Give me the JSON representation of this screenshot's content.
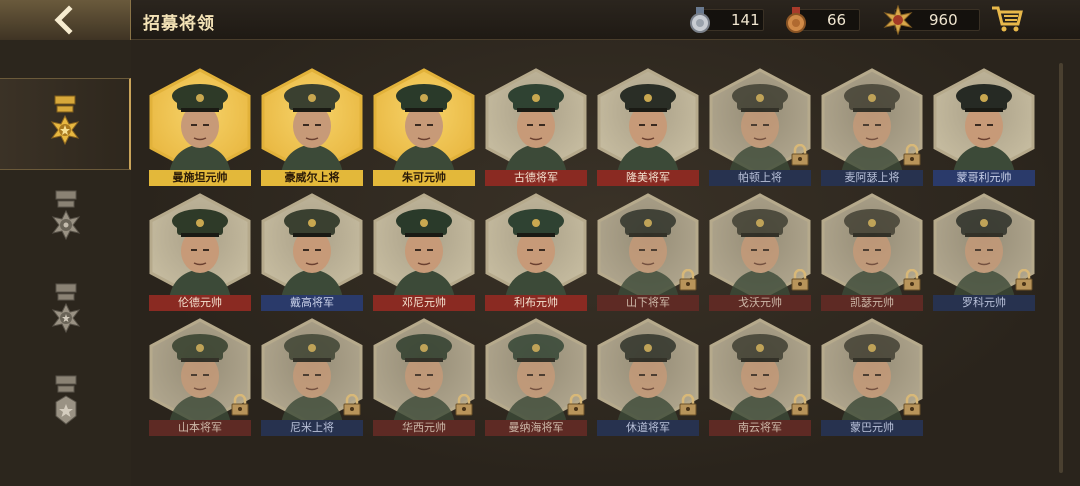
{
  "header": {
    "title": "招募将领",
    "resources": [
      {
        "icon": "silver-medal-icon",
        "value": "141"
      },
      {
        "icon": "bronze-medal-icon",
        "value": "66"
      },
      {
        "icon": "gold-star-badge-icon",
        "value": "960"
      }
    ]
  },
  "sidebar": {
    "tabs": [
      {
        "icon": "marshal-rank-medal-icon",
        "active": true
      },
      {
        "icon": "general-rank-medal-icon",
        "active": false
      },
      {
        "icon": "lieutenant-rank-medal-icon",
        "active": false
      },
      {
        "icon": "major-rank-medal-icon",
        "active": false
      }
    ]
  },
  "generals": [
    [
      {
        "name": "曼施坦元帅",
        "style": "yellow",
        "locked": false
      },
      {
        "name": "豪威尔上将",
        "style": "yellow",
        "locked": false
      },
      {
        "name": "朱可元帅",
        "style": "yellow",
        "locked": false
      },
      {
        "name": "古德将军",
        "style": "red",
        "locked": false
      },
      {
        "name": "隆美将军",
        "style": "red",
        "locked": false
      },
      {
        "name": "帕顿上将",
        "style": "blue",
        "locked": true
      },
      {
        "name": "麦阿瑟上将",
        "style": "blue",
        "locked": true
      },
      {
        "name": "蒙哥利元帅",
        "style": "blue",
        "locked": false
      }
    ],
    [
      {
        "name": "伦德元帅",
        "style": "red",
        "locked": false
      },
      {
        "name": "戴高将军",
        "style": "blue",
        "locked": false
      },
      {
        "name": "邓尼元帅",
        "style": "red",
        "locked": false
      },
      {
        "name": "利布元帅",
        "style": "red",
        "locked": false
      },
      {
        "name": "山下将军",
        "style": "red",
        "locked": true
      },
      {
        "name": "戈沃元帅",
        "style": "red",
        "locked": true
      },
      {
        "name": "凯瑟元帅",
        "style": "red",
        "locked": true
      },
      {
        "name": "罗科元帅",
        "style": "blue",
        "locked": true
      }
    ],
    [
      {
        "name": "山本将军",
        "style": "red",
        "locked": true
      },
      {
        "name": "尼米上将",
        "style": "blue",
        "locked": true
      },
      {
        "name": "华西元帅",
        "style": "red",
        "locked": true
      },
      {
        "name": "曼纳海将军",
        "style": "red",
        "locked": true
      },
      {
        "name": "休道将军",
        "style": "blue",
        "locked": true
      },
      {
        "name": "南云将军",
        "style": "red",
        "locked": true
      },
      {
        "name": "蒙巴元帅",
        "style": "blue",
        "locked": true
      }
    ]
  ],
  "colors": {
    "gold_frame": "#e2b23a",
    "silver_frame": "#b6aa8c",
    "red_band": "#8a2a22",
    "blue_band": "#2a3a6a"
  }
}
